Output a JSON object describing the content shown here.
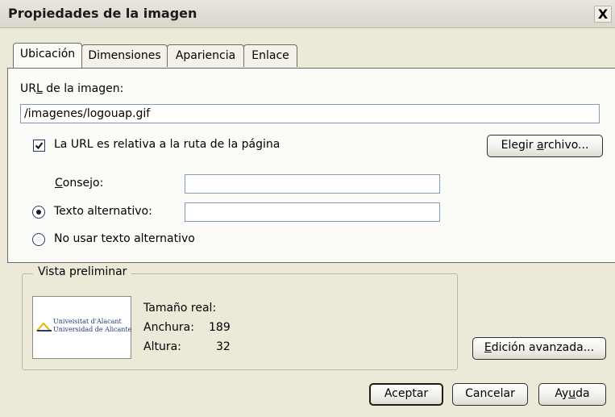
{
  "window": {
    "title": "Propiedades de la imagen",
    "close_glyph": "X"
  },
  "tabs": [
    "Ubicación",
    "Dimensiones",
    "Apariencia",
    "Enlace"
  ],
  "location": {
    "url_label_pre": "UR",
    "url_label_mnemonic": "L",
    "url_label_post": " de la imagen:",
    "url_value": "/imagenes/logouap.gif",
    "relative_label": "La URL es relativa a la ruta de la página",
    "relative_checked": true,
    "choose_pre": "Elegir ",
    "choose_mnemonic": "a",
    "choose_post": "rchivo...",
    "tooltip_mnemonic": "C",
    "tooltip_post": "onsejo:",
    "tooltip_value": "",
    "alt_label": "Texto alternativo:",
    "alt_value": "",
    "alt_selected": true,
    "noalt_label": "No usar texto alternativo"
  },
  "preview": {
    "legend": "Vista preliminar",
    "real_size": "Tamaño real:",
    "width_label": "Anchura:",
    "width_value": "189",
    "height_label": "Altura:",
    "height_value": "32",
    "logo_line1": "Univeisitat d'Alacant",
    "logo_line2": "Universidad de Alicante"
  },
  "advanced_edit": {
    "mnemonic": "E",
    "post": "dición avanzada..."
  },
  "footer": {
    "accept": "Aceptar",
    "cancel": "Cancelar",
    "help_pre": "Ay",
    "help_mnemonic": "u",
    "help_post": "da"
  },
  "colors": {
    "logo_blue": "#223a7a",
    "logo_yellow": "#e7b600"
  }
}
